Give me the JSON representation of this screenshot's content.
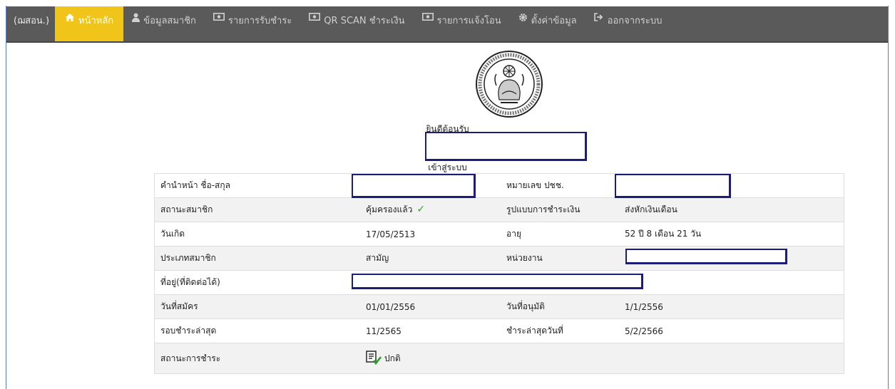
{
  "nav": {
    "brand": "(ฌสอน.)",
    "items": [
      {
        "label": "หน้าหลัก",
        "icon": "home-icon",
        "active": true
      },
      {
        "label": "ข้อมูลสมาชิก",
        "icon": "user-icon"
      },
      {
        "label": "รายการรับชำระ",
        "icon": "money-icon"
      },
      {
        "label": "QR SCAN ชำระเงิน",
        "icon": "money-icon"
      },
      {
        "label": "รายการแจ้งโอน",
        "icon": "money-icon"
      },
      {
        "label": "ตั้งค่าข้อมูล",
        "icon": "gear-icon"
      },
      {
        "label": "ออกจากระบบ",
        "icon": "logout-icon"
      }
    ]
  },
  "welcome": {
    "line1": "ยินดีต้อนรับ",
    "line2": "เข้าสู่ระบบ"
  },
  "info": {
    "rows": [
      {
        "l1": "คำนำหน้า ชื่อ-สกุล",
        "v1": "",
        "l2": "หมายเลข ปชช.",
        "v2": ""
      },
      {
        "l1": "สถานะสมาชิก",
        "v1": "คุ้มครองแล้ว",
        "l2": "รูปแบบการชำระเงิน",
        "v2": "ส่งหักเงินเดือน"
      },
      {
        "l1": "วันเกิด",
        "v1": "17/05/2513",
        "l2": "อายุ",
        "v2": "52 ปี 8 เดือน 21 วัน"
      },
      {
        "l1": "ประเภทสมาชิก",
        "v1": "สามัญ",
        "l2": "หน่วยงาน",
        "v2": ""
      },
      {
        "l1": "ที่อยู่(ที่ติดต่อได้)",
        "v1": "",
        "l2": "",
        "v2": ""
      },
      {
        "l1": "วันที่สมัคร",
        "v1": "01/01/2556",
        "l2": "วันที่อนุมัติ",
        "v2": "1/1/2556"
      },
      {
        "l1": "รอบชำระล่าสุด",
        "v1": "11/2565",
        "l2": "ชำระล่าสุดวันที่",
        "v2": "5/2/2566"
      },
      {
        "l1": "สถานะการชำระ",
        "v1": "ปกติ",
        "l2": "",
        "v2": ""
      }
    ]
  },
  "colors": {
    "navbar": "#5a5a5a",
    "active": "#f0c419",
    "redact_border": "#1c1c7a",
    "check": "#2ca02c"
  }
}
